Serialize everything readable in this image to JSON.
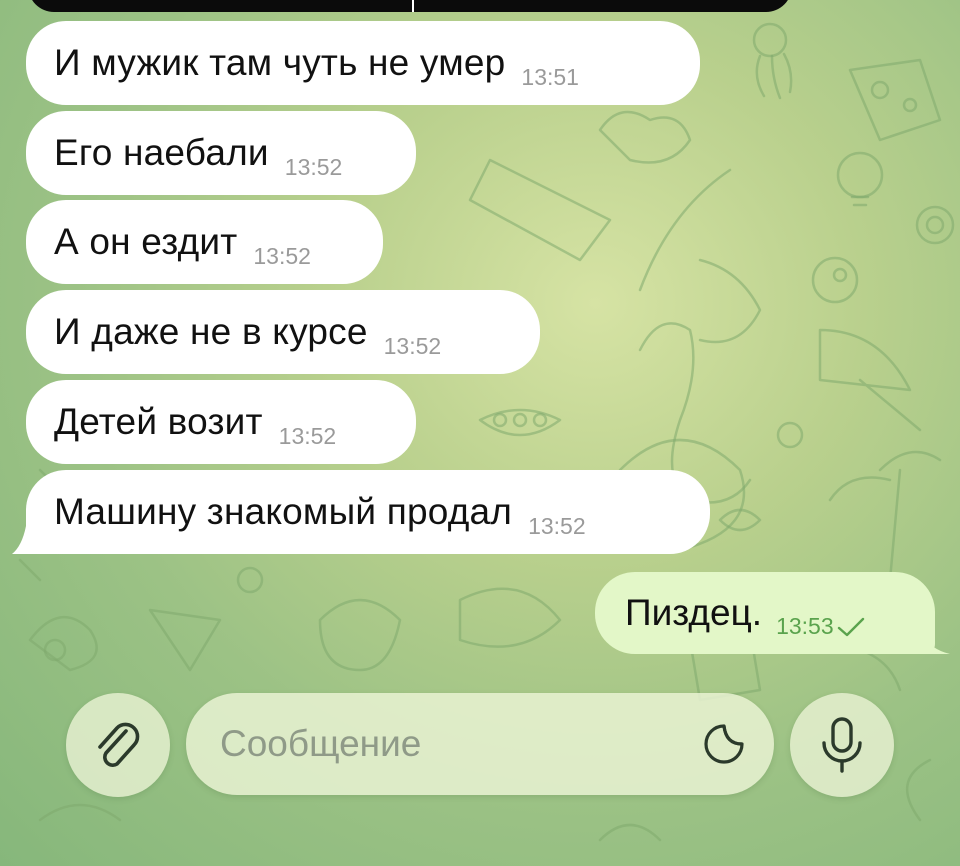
{
  "messages_in": [
    {
      "text": "И мужик там чуть не умер",
      "time": "13:51"
    },
    {
      "text": "Его наебали",
      "time": "13:52"
    },
    {
      "text": "А он ездит",
      "time": "13:52"
    },
    {
      "text": "И даже не в курсе",
      "time": "13:52"
    },
    {
      "text": "Детей возит",
      "time": "13:52"
    },
    {
      "text": "Машину знакомый продал",
      "time": "13:52"
    }
  ],
  "message_out": {
    "text": "Пиздец.",
    "time": "13:53",
    "status_icon": "check-icon"
  },
  "composer": {
    "placeholder": "Сообщение",
    "value": "",
    "attach_icon": "paperclip-icon",
    "sticker_icon": "sticker-icon",
    "mic_icon": "microphone-icon"
  },
  "colors": {
    "incoming_bubble": "#ffffff",
    "outgoing_bubble": "#e3f7c8",
    "outgoing_time": "#5aa34d",
    "incoming_time": "#9a9a9a",
    "wallpaper": "#b9d08d"
  }
}
